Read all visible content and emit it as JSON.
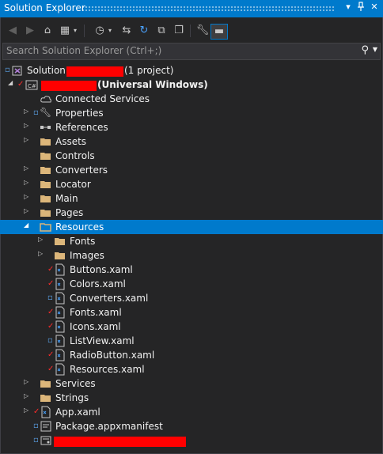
{
  "panel": {
    "title": "Solution Explorer",
    "pin_icon": "pin-icon",
    "dropdown_icon": "chevron-down-icon",
    "close_icon": "close-icon",
    "accent": "#007acc"
  },
  "search": {
    "placeholder": "Search Solution Explorer (Ctrl+;)"
  },
  "tree": {
    "solution_prefix": "Solution",
    "solution_suffix": "(1 project)",
    "project_suffix": "(Universal Windows)",
    "items": [
      {
        "label": "Connected Services"
      },
      {
        "label": "Properties"
      },
      {
        "label": "References"
      },
      {
        "label": "Assets"
      },
      {
        "label": "Controls"
      },
      {
        "label": "Converters"
      },
      {
        "label": "Locator"
      },
      {
        "label": "Main"
      },
      {
        "label": "Pages"
      },
      {
        "label": "Resources"
      },
      {
        "label": "Fonts"
      },
      {
        "label": "Images"
      },
      {
        "label": "Buttons.xaml"
      },
      {
        "label": "Colors.xaml"
      },
      {
        "label": "Converters.xaml"
      },
      {
        "label": "Fonts.xaml"
      },
      {
        "label": "Icons.xaml"
      },
      {
        "label": "ListView.xaml"
      },
      {
        "label": "RadioButton.xaml"
      },
      {
        "label": "Resources.xaml"
      },
      {
        "label": "Services"
      },
      {
        "label": "Strings"
      },
      {
        "label": "App.xaml"
      },
      {
        "label": "Package.appxmanifest"
      }
    ]
  }
}
